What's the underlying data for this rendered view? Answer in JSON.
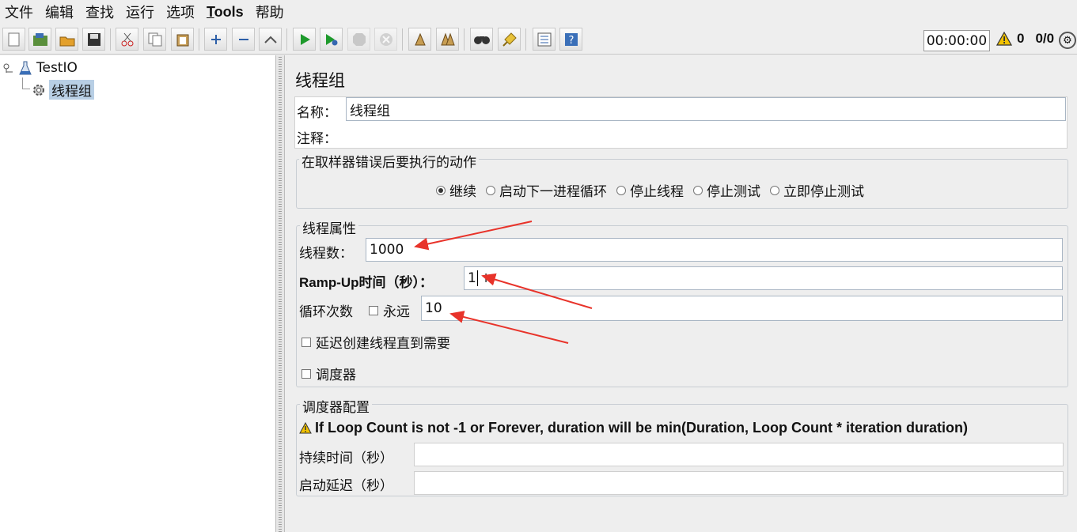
{
  "menubar": {
    "items": [
      "文件",
      "编辑",
      "查找",
      "运行",
      "选项",
      "Tools",
      "帮助"
    ]
  },
  "toolbar": {
    "icons": [
      "new-icon",
      "templates-icon",
      "open-icon",
      "save-icon",
      "cut-icon",
      "copy-icon",
      "paste-icon",
      "expand-icon",
      "collapse-icon",
      "toggle-icon",
      "start-icon",
      "start-no-pause-icon",
      "stop-icon",
      "shutdown-icon",
      "clear-icon",
      "clear-all-icon",
      "search-icon",
      "reset-search-icon",
      "function-helper-icon",
      "help-icon"
    ],
    "timer": "00:00:00",
    "warning_count": "0",
    "thread_ratio": "0/0"
  },
  "tree": {
    "root": "TestIO",
    "child": "线程组"
  },
  "main": {
    "title": "线程组",
    "name_label": "名称：",
    "name_value": "线程组",
    "comment_label": "注释：",
    "comment_value": "",
    "error_group": {
      "legend": "在取样器错误后要执行的动作",
      "options": [
        "继续",
        "启动下一进程循环",
        "停止线程",
        "停止测试",
        "立即停止测试"
      ],
      "selected": "继续"
    },
    "thread_props": {
      "legend": "线程属性",
      "threads_label": "线程数：",
      "threads_value": "1000",
      "rampup_label": "Ramp-Up时间（秒）：",
      "rampup_value": "1",
      "loop_label": "循环次数",
      "forever_label": "永远",
      "loop_value": "10",
      "delay_label": "延迟创建线程直到需要",
      "scheduler_label": "调度器"
    },
    "scheduler_config": {
      "legend": "调度器配置",
      "warning": "If Loop Count is not -1 or Forever, duration will be min(Duration, Loop Count * iteration duration)",
      "duration_label": "持续时间（秒）",
      "duration_value": "",
      "startup_label": "启动延迟（秒）",
      "startup_value": ""
    }
  },
  "colors": {
    "annotation_arrow": "#e8332a",
    "selection": "#b8cfe5"
  }
}
